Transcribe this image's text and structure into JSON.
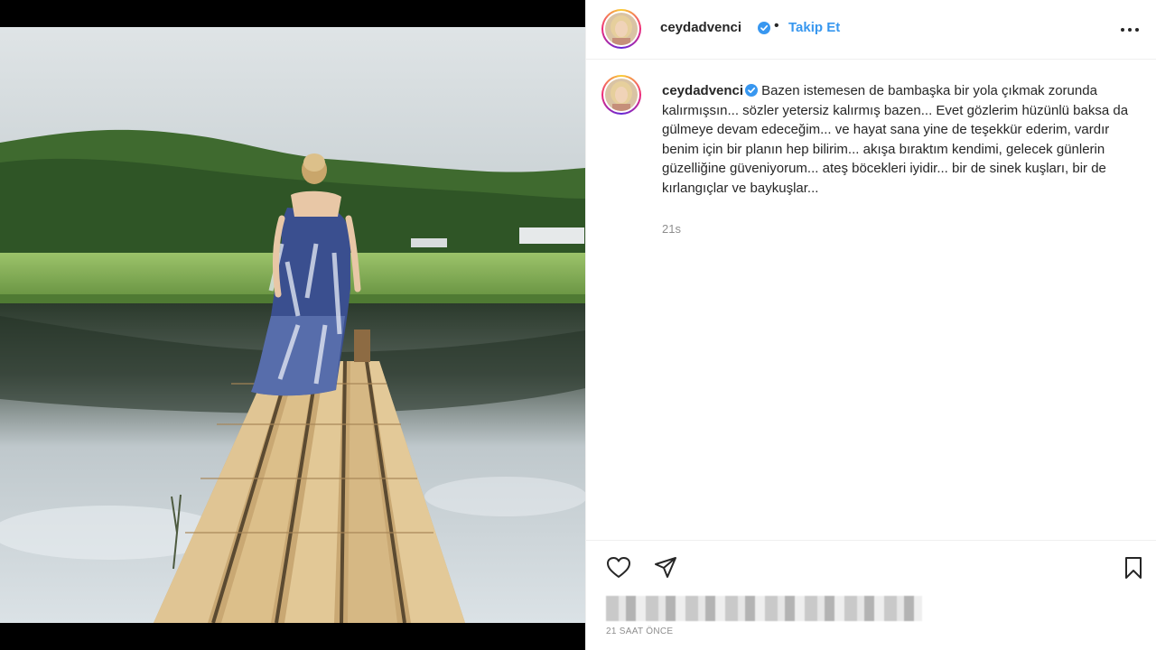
{
  "post": {
    "username": "ceydadvenci",
    "follow_label": "Takip Et",
    "header_separator": "•",
    "caption_username": "ceydadvenci",
    "caption_text": "Bazen istemesen de bambaşka bir yola çıkmak zorunda kalırmışsın... sözler yetersiz kalırmış bazen... Evet gözlerim hüzünlü baksa da gülmeye devam edeceğim... ve hayat sana yine de teşekkür ederim, vardır benim için bir planın hep bilirim... akışa bıraktım kendimi, gelecek günlerin güzelliğine güveniyorum... ateş böcekleri iyidir... bir de sinek kuşları, bir de kırlangıçlar ve baykuşlar...",
    "caption_time": "21s",
    "post_date": "21 SAAT ÖNCE"
  },
  "icons": {
    "verified": "verified-badge-icon",
    "more": "more-options-icon",
    "like": "heart-icon",
    "share": "paper-plane-icon",
    "save": "bookmark-icon"
  },
  "colors": {
    "verified_blue": "#3897f0",
    "follow_blue": "#3797ef",
    "text": "#262626",
    "muted": "#8e8e8e"
  }
}
